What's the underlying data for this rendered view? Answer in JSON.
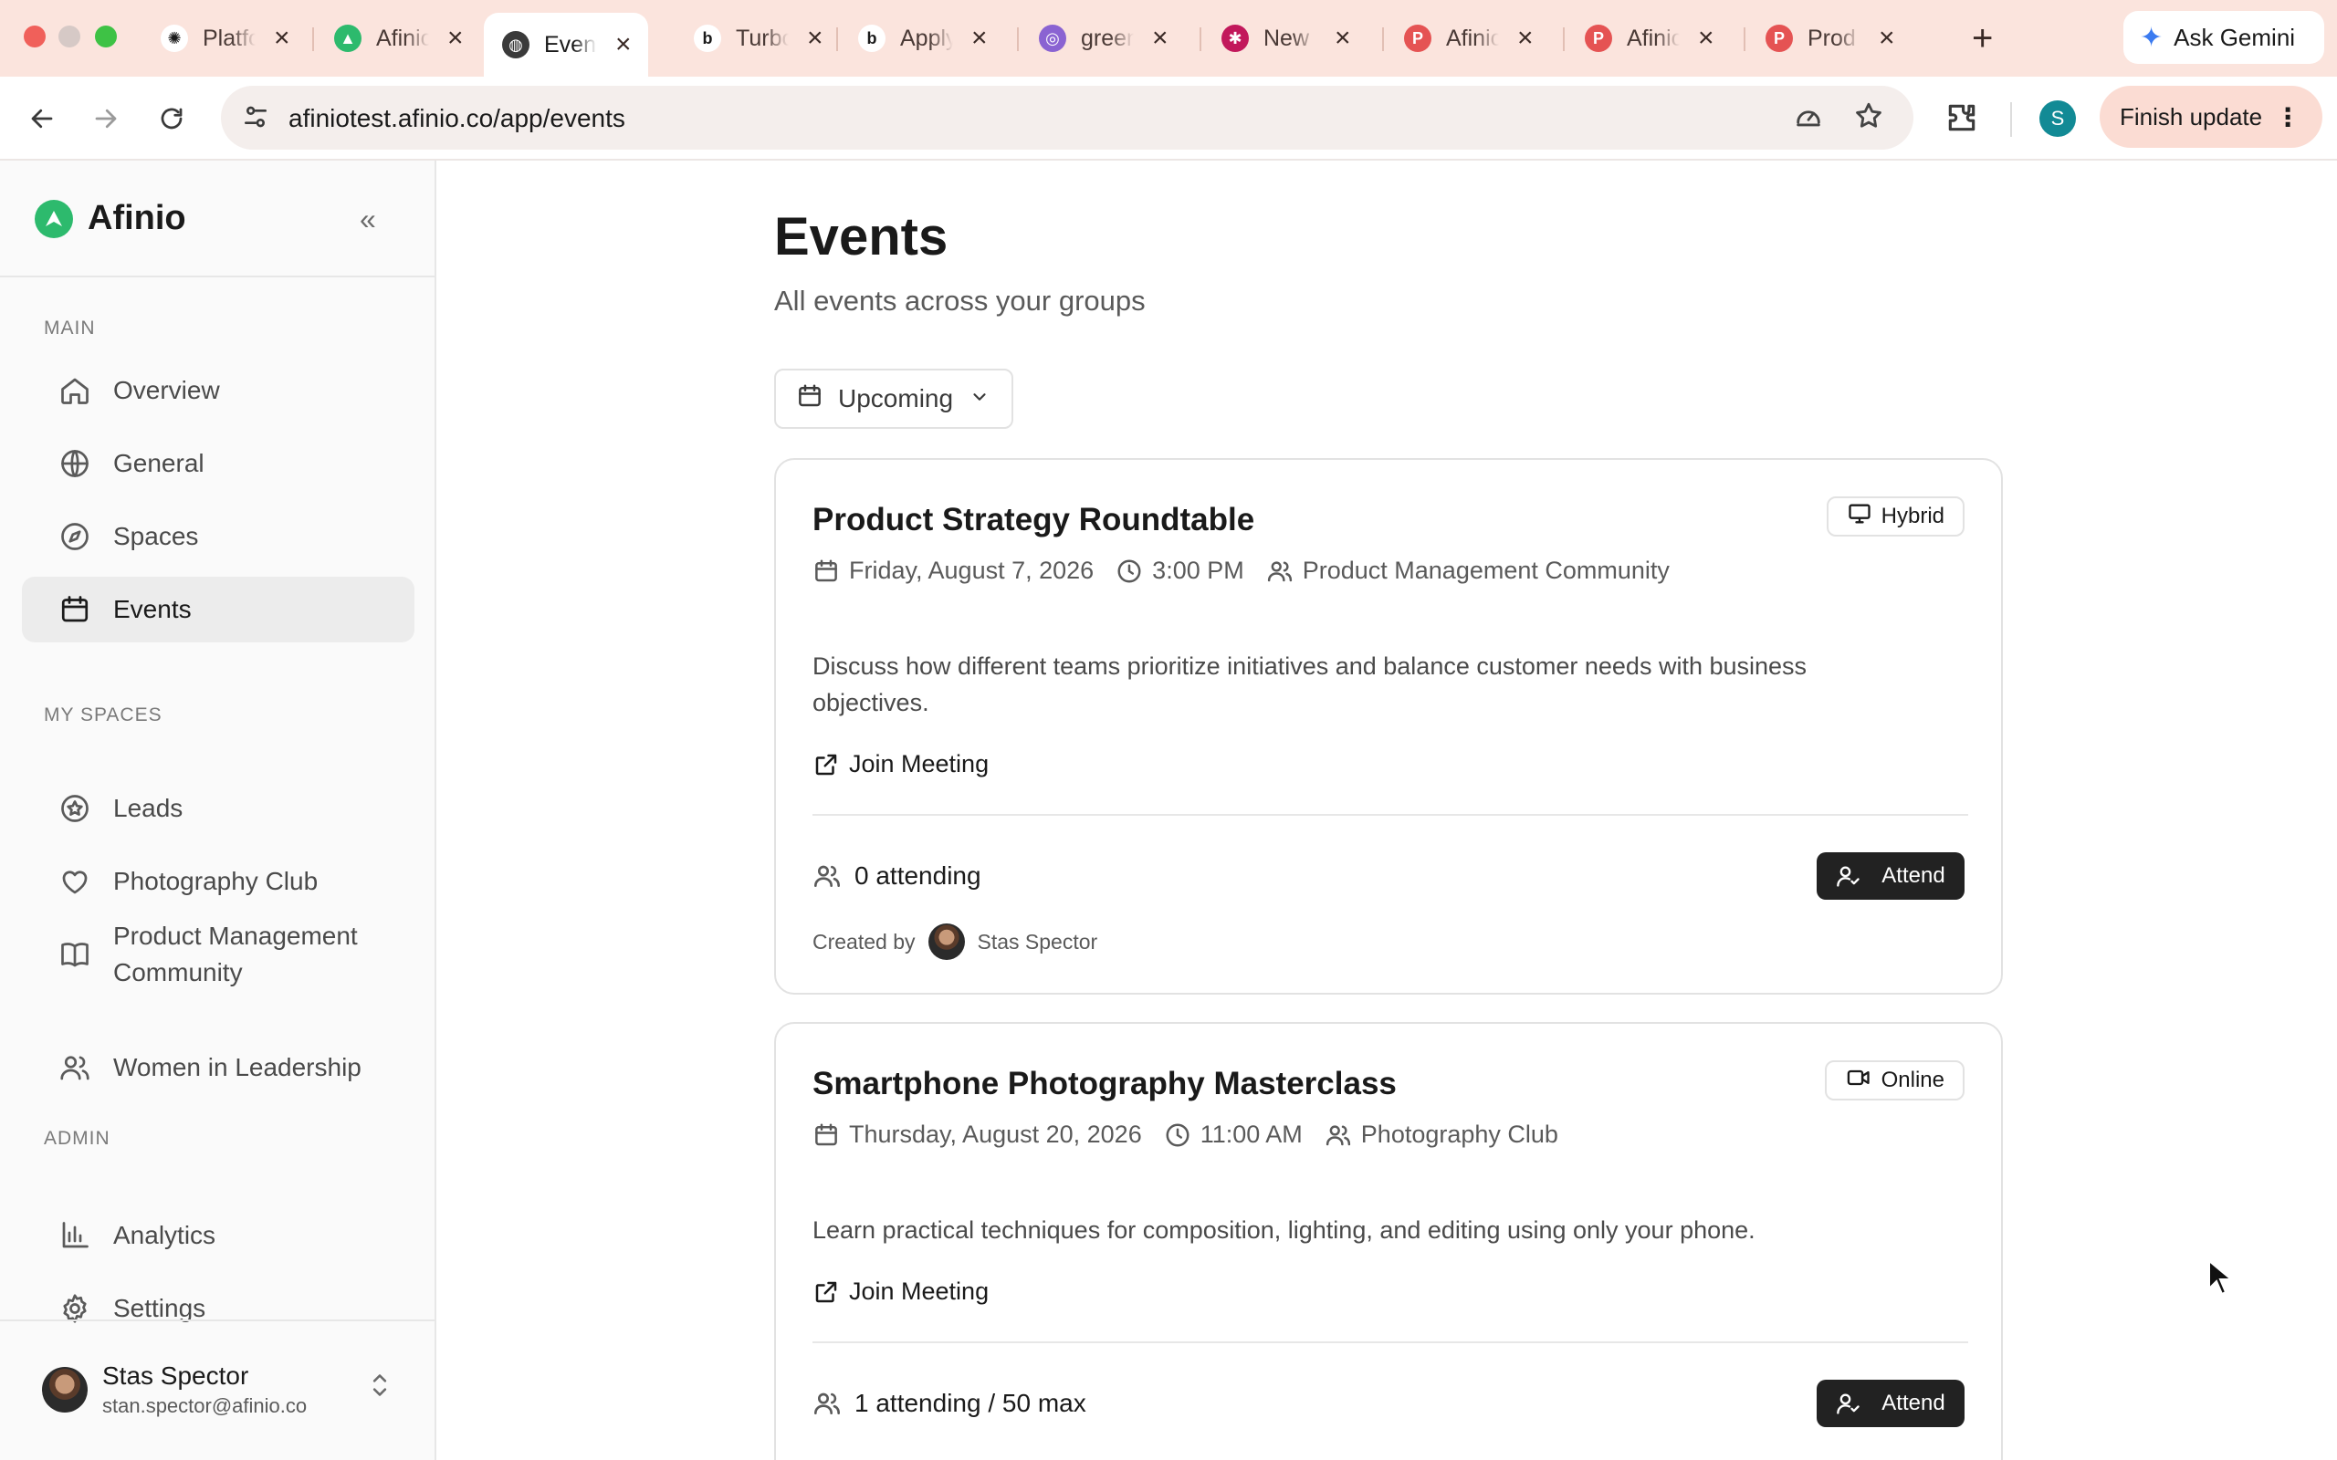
{
  "browser": {
    "tabs": [
      {
        "title": "Platform",
        "favicon": "openai-icon",
        "favicon_color": "#ffffff",
        "glyph": "✺"
      },
      {
        "title": "Afinio",
        "favicon": "afinio-logo-icon",
        "favicon_color": "#2dba6d",
        "glyph": "▲"
      },
      {
        "title": "Events",
        "favicon": "globe-icon",
        "favicon_color": "#3a3a3a",
        "glyph": "◍",
        "active": true
      },
      {
        "title": "Turbo",
        "favicon": "b-logo-icon",
        "favicon_color": "#ffffff",
        "glyph": "b"
      },
      {
        "title": "Apply",
        "favicon": "b-logo-icon",
        "favicon_color": "#ffffff",
        "glyph": "b"
      },
      {
        "title": "green",
        "favicon": "purple-logo-icon",
        "favicon_color": "#8a63d2",
        "glyph": "◎"
      },
      {
        "title": "New",
        "favicon": "red-logo-icon",
        "favicon_color": "#c2185b",
        "glyph": "✱"
      },
      {
        "title": "Afinio",
        "favicon": "p-logo-icon",
        "favicon_color": "#e55353",
        "glyph": "P"
      },
      {
        "title": "Afinio",
        "favicon": "p-logo-icon",
        "favicon_color": "#e55353",
        "glyph": "P"
      },
      {
        "title": "Prod",
        "favicon": "p-logo-icon",
        "favicon_color": "#e55353",
        "glyph": "P"
      }
    ],
    "new_tab": "+",
    "gemini_label": "Ask Gemini",
    "url": "afiniotest.afinio.co/app/events",
    "profile_initial": "S",
    "finish_update_label": "Finish update"
  },
  "sidebar": {
    "brand": "Afinio",
    "collapse": "«",
    "sections": {
      "main": "MAIN",
      "my_spaces": "MY SPACES",
      "admin": "ADMIN"
    },
    "main_items": [
      {
        "label": "Overview",
        "icon": "home-icon"
      },
      {
        "label": "General",
        "icon": "globe-icon"
      },
      {
        "label": "Spaces",
        "icon": "compass-icon"
      },
      {
        "label": "Events",
        "icon": "calendar-icon",
        "active": true
      }
    ],
    "space_items": [
      {
        "label": "Leads",
        "icon": "star-badge-icon"
      },
      {
        "label": "Photography Club",
        "icon": "heart-icon"
      },
      {
        "label": "Product Management Community",
        "icon": "book-icon"
      },
      {
        "label": "Women in Leadership",
        "icon": "users-icon"
      }
    ],
    "admin_items": [
      {
        "label": "Analytics",
        "icon": "bar-chart-icon"
      },
      {
        "label": "Settings",
        "icon": "gear-icon"
      }
    ],
    "user": {
      "name": "Stas Spector",
      "email": "stan.spector@afinio.co"
    }
  },
  "main": {
    "title": "Events",
    "subtitle": "All events across your groups",
    "filter_label": "Upcoming",
    "events": [
      {
        "title": "Product Strategy Roundtable",
        "type": "Hybrid",
        "date": "Friday, August 7, 2026",
        "time": "3:00 PM",
        "group": "Product Management Community",
        "description": "Discuss how different teams prioritize initiatives and balance customer needs with business objectives.",
        "join_label": "Join Meeting",
        "attending": "0 attending",
        "attend_label": "Attend",
        "created_by_label": "Created by",
        "creator": "Stas Spector"
      },
      {
        "title": "Smartphone Photography Masterclass",
        "type": "Online",
        "date": "Thursday, August 20, 2026",
        "time": "11:00 AM",
        "group": "Photography Club",
        "description": "Learn practical techniques for composition, lighting, and editing using only your phone.",
        "join_label": "Join Meeting",
        "attending": "1 attending / 50 max",
        "attend_label": "Attend"
      }
    ]
  },
  "colors": {
    "accent": "#2dba6d",
    "button_dark": "#222222",
    "tabbar": "#fbe4dd"
  }
}
